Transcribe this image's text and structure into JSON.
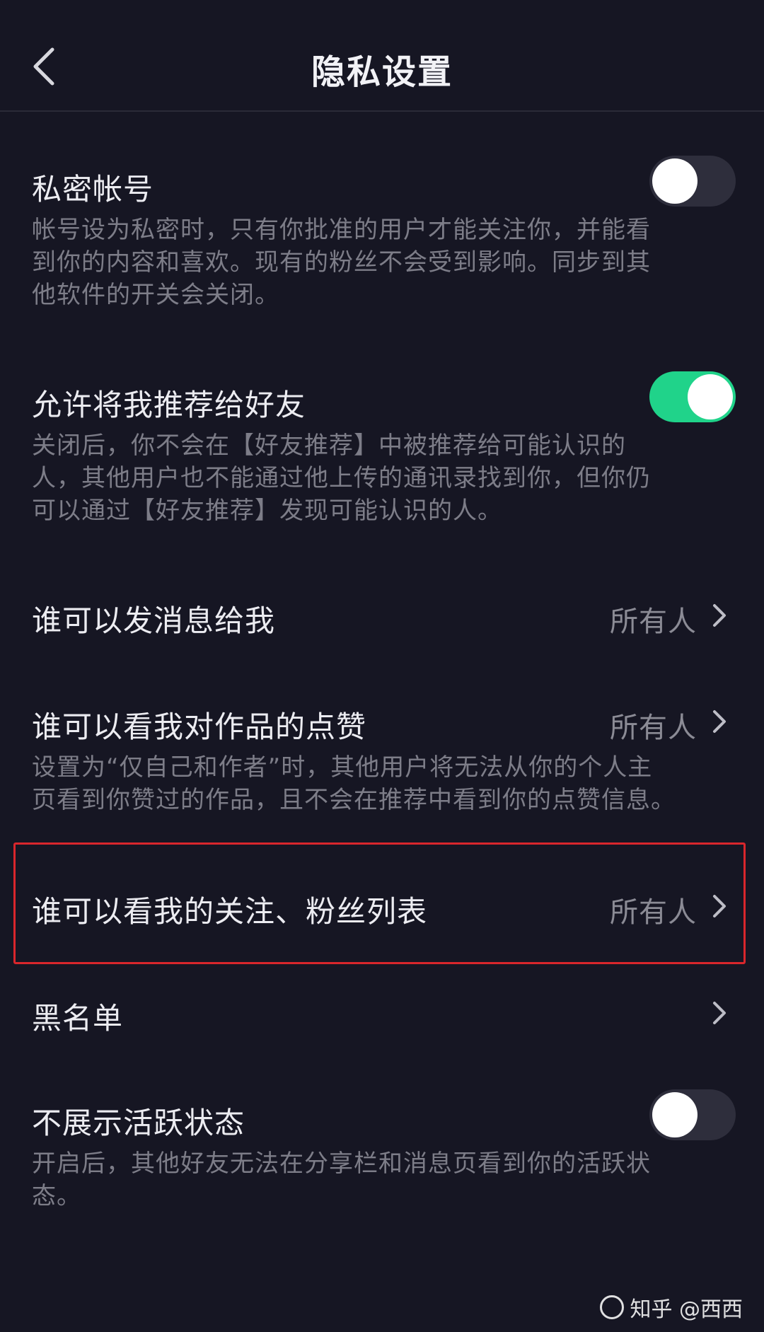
{
  "header": {
    "title": "隐私设置"
  },
  "colors": {
    "background": "#161623",
    "toggle_on": "#20d38a",
    "toggle_off": "#2e2e3c",
    "highlight": "#d9262c"
  },
  "settings": {
    "private_account": {
      "title": "私密帐号",
      "desc_lines": [
        "帐号设为私密时，只有你批准的用户才能关注你，并能看",
        "到你的内容和喜欢。现有的粉丝不会受到影响。同步到其",
        "他软件的开关会关闭。"
      ],
      "enabled": false
    },
    "recommend_to_friends": {
      "title": "允许将我推荐给好友",
      "desc_lines": [
        "关闭后，你不会在【好友推荐】中被推荐给可能认识的",
        "人，其他用户也不能通过他上传的通讯录找到你，但你仍",
        "可以通过【好友推荐】发现可能认识的人。"
      ],
      "enabled": true
    },
    "who_can_message": {
      "title": "谁可以发消息给我",
      "value": "所有人"
    },
    "who_can_see_likes": {
      "title": "谁可以看我对作品的点赞",
      "value": "所有人",
      "desc_lines": [
        "设置为“仅自己和作者”时，其他用户将无法从你的个人主",
        "页看到你赞过的作品，且不会在推荐中看到你的点赞信息。"
      ]
    },
    "who_can_see_follow_list": {
      "title": "谁可以看我的关注、粉丝列表",
      "value": "所有人"
    },
    "blacklist": {
      "title": "黑名单"
    },
    "hide_active_status": {
      "title": "不展示活跃状态",
      "desc_lines": [
        "开启后，其他好友无法在分享栏和消息页看到你的活跃状",
        "态。"
      ],
      "enabled": false
    }
  },
  "watermark": {
    "text": "知乎 @西西"
  }
}
